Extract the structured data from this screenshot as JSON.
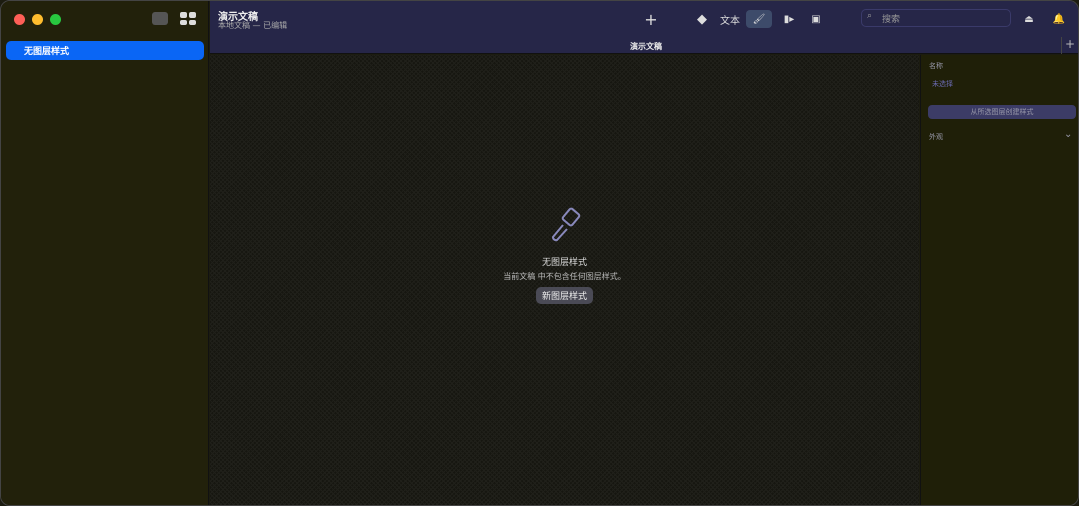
{
  "sidebar": {
    "selected_item": "无图层样式"
  },
  "toolbar": {
    "title": "演示文稿",
    "subtitle": "本地文稿 — 已编辑",
    "add": "+",
    "text_label": "文本",
    "search_placeholder": "搜索"
  },
  "tabbar": {
    "tab_title": "演示文稿",
    "add": "+"
  },
  "canvas": {
    "empty_title": "无图层样式",
    "empty_desc": "当前文稿 中不包含任何图层样式。",
    "new_button": "新图层样式"
  },
  "inspector": {
    "name_label": "名称",
    "name_value": "未选择",
    "create_button": "从所选图层创建样式",
    "appearance_label": "外观"
  },
  "colors": {
    "accent": "#0a66f5",
    "toolbar": "#262648"
  }
}
